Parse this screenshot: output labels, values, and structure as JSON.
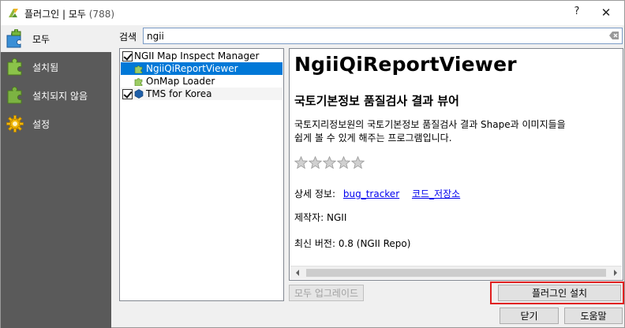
{
  "window": {
    "title": "플러그인 | 모두",
    "count": "(788)",
    "help_label": "?",
    "close_label": "✕"
  },
  "sidebar": {
    "items": [
      {
        "label": "모두",
        "icon": "puzzle-all-icon",
        "active": true
      },
      {
        "label": "설치됨",
        "icon": "puzzle-installed-icon",
        "active": false
      },
      {
        "label": "설치되지 않음",
        "icon": "puzzle-not-installed-icon",
        "active": false
      },
      {
        "label": "설정",
        "icon": "gear-icon",
        "active": false
      }
    ]
  },
  "search": {
    "label": "검색",
    "value": "ngii"
  },
  "plugins": [
    {
      "name": "NGII Map Inspect Manager",
      "checked": true,
      "selected": false
    },
    {
      "name": "NgiiQiReportViewer",
      "checked": false,
      "selected": true
    },
    {
      "name": "OnMap Loader",
      "checked": false,
      "selected": false
    },
    {
      "name": "TMS for Korea",
      "checked": true,
      "selected": false
    }
  ],
  "detail": {
    "title": "NgiiQiReportViewer",
    "subtitle": "국토기본정보 품질검사 결과 뷰어",
    "description_line1": "국토지리정보원의 국토기본정보 품질검사 결과 Shape과 이미지들을",
    "description_line2": "쉽게 볼 수 있게 해주는 프로그램입니다.",
    "rating_stars": 0,
    "rating_max": 5,
    "more_info_label": "상세 정보:",
    "link_bug_tracker": "bug_tracker",
    "link_code_repo": "코드_저장소",
    "author_label": "제작자:",
    "author_value": "NGII",
    "version_label": "최신 버전:",
    "version_value": "0.8 (NGII Repo)"
  },
  "buttons": {
    "upgrade_all": "모두 업그레이드",
    "install_plugin": "플러그인 설치",
    "close": "닫기",
    "help": "도움말"
  },
  "colors": {
    "sidebar_bg": "#5a5a5a",
    "selection": "#0078d7",
    "link": "#0000ee",
    "highlight": "#e02020"
  }
}
